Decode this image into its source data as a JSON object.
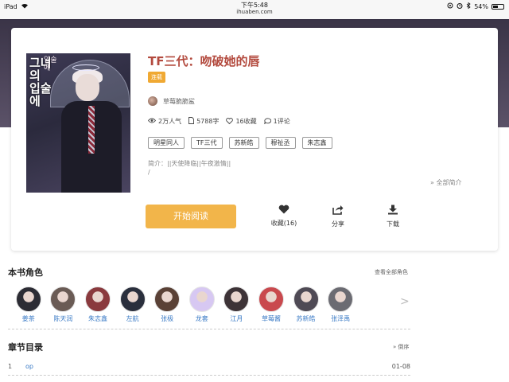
{
  "statusbar": {
    "device": "iPad",
    "time": "下午5:48",
    "url": "ihuaben.com",
    "battery": "54%",
    "battery_level": 0.54
  },
  "book": {
    "title": "TF三代：吻破她的唇",
    "status_badge": "连载",
    "author": "草莓脆脆鲨",
    "stats": {
      "popularity": "2万人气",
      "words": "5788字",
      "favorites": "16收藏",
      "comments": "1评论"
    },
    "tags": [
      "明星同人",
      "TF三代",
      "苏新皓",
      "穆祉丞",
      "朱志鑫"
    ],
    "intro": "简介：||天使降临||午夜激情||",
    "intro_extra": "/",
    "more_intro": "全部简介",
    "cover_text": "그녀의 입술에",
    "cover_text_small": "입술에"
  },
  "actions": {
    "read": "开始阅读",
    "favorite": "收藏(16)",
    "share": "分享",
    "download": "下载"
  },
  "characters_section": {
    "title": "本书角色",
    "view_all": "查看全部角色",
    "items": [
      {
        "name": "姜茶",
        "color": "#2c2c34"
      },
      {
        "name": "陈天润",
        "color": "#6a5b55"
      },
      {
        "name": "朱志鑫",
        "color": "#8a3a3e"
      },
      {
        "name": "左航",
        "color": "#2a2f3d"
      },
      {
        "name": "张极",
        "color": "#5a4136"
      },
      {
        "name": "龙套",
        "color": "#d7c8f2"
      },
      {
        "name": "江月",
        "color": "#3d3337"
      },
      {
        "name": "草莓酱",
        "color": "#c9494e"
      },
      {
        "name": "苏新皓",
        "color": "#4f4a55"
      },
      {
        "name": "张泽禹",
        "color": "#6b6b72"
      }
    ]
  },
  "chapters_section": {
    "title": "章节目录",
    "sort": "倒序",
    "items": [
      {
        "num": "1",
        "name": "op",
        "date": "01-08"
      }
    ]
  }
}
